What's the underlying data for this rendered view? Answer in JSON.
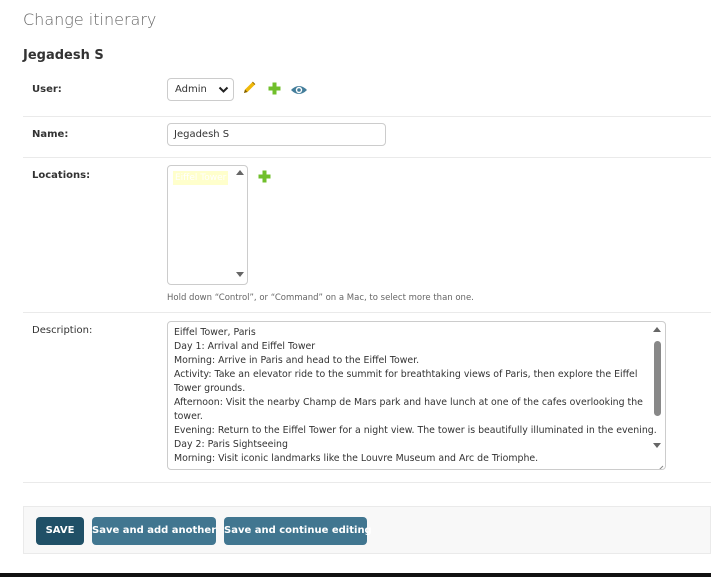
{
  "page": {
    "title": "Change itinerary",
    "object_name": "Jegadesh S"
  },
  "colors": {
    "primary_button": "#205067",
    "secondary_button": "#417690",
    "add_icon": "#70bf2b",
    "change_icon": "#efb80b",
    "view_icon": "#447e9b",
    "selected_option_bg": "#ffffcc"
  },
  "form": {
    "user": {
      "label": "User:",
      "selected": "Admin",
      "icons": [
        "pencil-icon",
        "plus-icon",
        "eye-icon"
      ]
    },
    "name": {
      "label": "Name:",
      "value": "Jegadesh S"
    },
    "locations": {
      "label": "Locations:",
      "options": [
        "Eiffel Tower"
      ],
      "help_text": "Hold down “Control”, or “Command” on a Mac, to select more than one."
    },
    "description": {
      "label": "Description:",
      "lines": [
        "Eiffel Tower, Paris",
        "Day 1: Arrival and Eiffel Tower",
        "Morning: Arrive in Paris and head to the Eiffel Tower.",
        "Activity: Take an elevator ride to the summit for breathtaking views of Paris, then explore the Eiffel",
        "Tower grounds.",
        "Afternoon: Visit the nearby Champ de Mars park and have lunch at one of the cafes overlooking the",
        "tower.",
        "Evening: Return to the Eiffel Tower for a night view. The tower is beautifully illuminated in the evening.",
        "Day 2: Paris Sightseeing",
        "Morning: Visit iconic landmarks like the Louvre Museum and Arc de Triomphe."
      ]
    }
  },
  "buttons": {
    "save": "SAVE",
    "save_add_another": "Save and add another",
    "save_continue": "Save and continue editing"
  }
}
